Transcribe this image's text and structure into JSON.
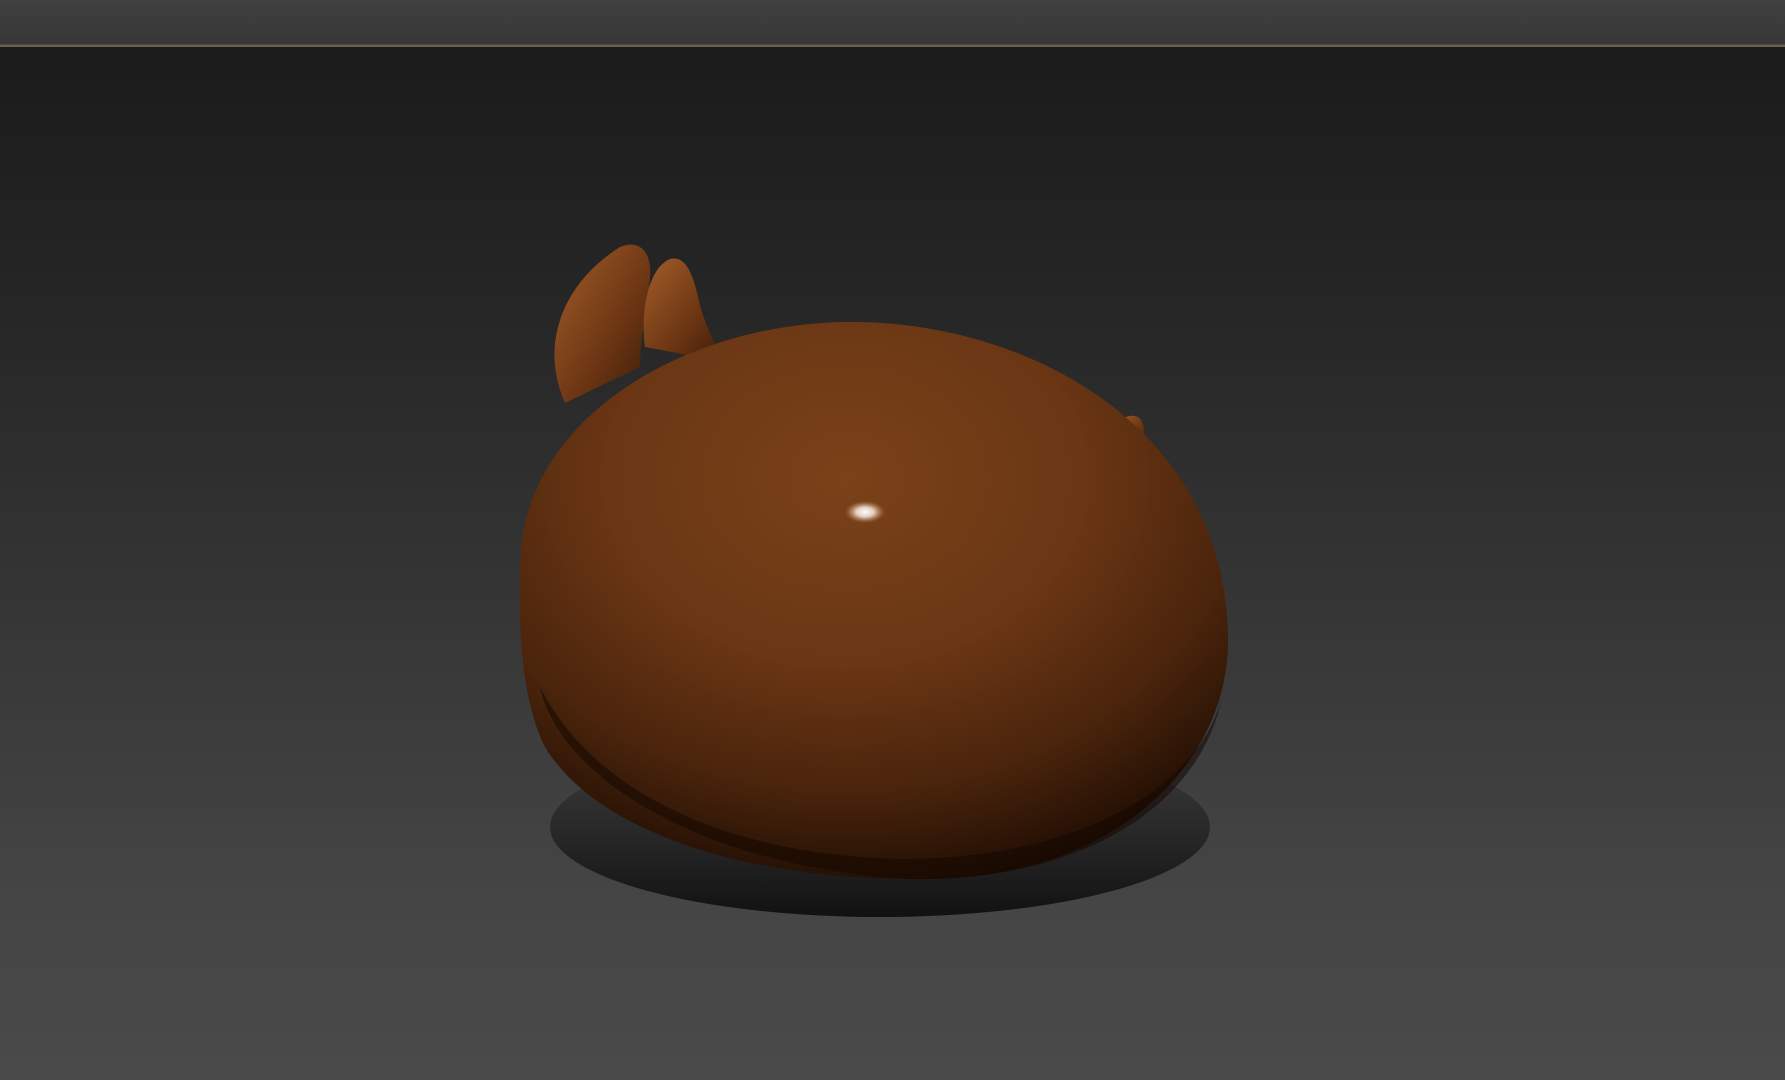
{
  "window": {
    "toolbar": {
      "items": []
    }
  },
  "viewport": {
    "background_top": "#1b1b1b",
    "background_bottom": "#4a4a4a",
    "model": {
      "icon": "3d-blob-model",
      "material_color": "#6e3a16",
      "highlight_color": "#ffffff"
    }
  }
}
